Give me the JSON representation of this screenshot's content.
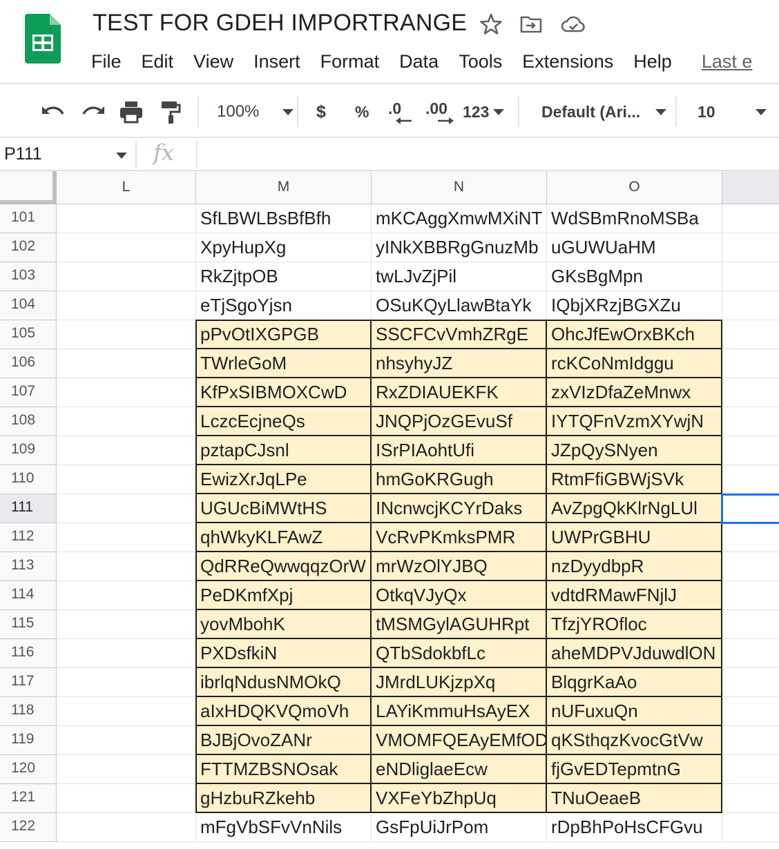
{
  "app": {
    "doc_title": "TEST FOR GDEH IMPORTRANGE",
    "icons": [
      "sheets-logo-icon",
      "star-icon",
      "move-to-folder-icon",
      "cloud-status-icon"
    ],
    "brand_color": "#0f9d58"
  },
  "menu": {
    "items": [
      "File",
      "Edit",
      "View",
      "Insert",
      "Format",
      "Data",
      "Tools",
      "Extensions",
      "Help"
    ],
    "last_edit": "Last e"
  },
  "toolbar": {
    "zoom": "100%",
    "currency": "$",
    "percent": "%",
    "decrease_decimals": ".0",
    "increase_decimals": ".00",
    "more_formats": "123",
    "font": "Default (Ari...",
    "font_size": "10"
  },
  "formula_bar": {
    "cell_ref": "P111",
    "fx": "fx",
    "value": ""
  },
  "sheet": {
    "columns": [
      "L",
      "M",
      "N",
      "O"
    ],
    "selected_row": 111,
    "highlight_color": "#fff2cc",
    "selection_color": "#1a73e8",
    "rows": [
      {
        "num": "101",
        "M": "SfLBWLBsBfBfh",
        "N": "mKCAggXmwMXiNT",
        "O": "WdSBmRnoMSBa"
      },
      {
        "num": "102",
        "M": "XpyHupXg",
        "N": "yINkXBBRgGnuzMb",
        "O": "uGUWUaHM"
      },
      {
        "num": "103",
        "M": "RkZjtpOB",
        "N": "twLJvZjPil",
        "O": "GKsBgMpn"
      },
      {
        "num": "104",
        "M": "eTjSgoYjsn",
        "N": "OSuKQyLlawBtaYk",
        "O": "IQbjXRzjBGXZu"
      },
      {
        "num": "105",
        "M": "pPvOtIXGPGB",
        "N": "SSCFCvVmhZRgE",
        "O": "OhcJfEwOrxBKch"
      },
      {
        "num": "106",
        "M": "TWrleGoM",
        "N": "nhsyhyJZ",
        "O": "rcKCoNmIdggu"
      },
      {
        "num": "107",
        "M": "KfPxSIBMOXCwD",
        "N": "RxZDIAUEKFK",
        "O": "zxVIzDfaZeMnwx"
      },
      {
        "num": "108",
        "M": "LczcEcjneQs",
        "N": "JNQPjOzGEvuSf",
        "O": "IYTQFnVzmXYwjN"
      },
      {
        "num": "109",
        "M": "pztapCJsnl",
        "N": "ISrPIAohtUfi",
        "O": "JZpQySNyen"
      },
      {
        "num": "110",
        "M": "EwizXrJqLPe",
        "N": "hmGoKRGugh",
        "O": "RtmFfiGBWjSVk"
      },
      {
        "num": "111",
        "M": "UGUcBiMWtHS",
        "N": "INcnwcjKCYrDaks",
        "O": "AvZpgQkKlrNgLUl"
      },
      {
        "num": "112",
        "M": "qhWkyKLFAwZ",
        "N": "VcRvPKmksPMR",
        "O": "UWPrGBHU"
      },
      {
        "num": "113",
        "M": "QdRReQwwqqzOrW",
        "N": "mrWzOlYJBQ",
        "O": "nzDyydbpR"
      },
      {
        "num": "114",
        "M": "PeDKmfXpj",
        "N": "OtkqVJyQx",
        "O": "vdtdRMawFNjlJ"
      },
      {
        "num": "115",
        "M": "yovMbohK",
        "N": "tMSMGylAGUHRpt",
        "O": "TfzjYROfloc"
      },
      {
        "num": "116",
        "M": "PXDsfkiN",
        "N": "QTbSdokbfLc",
        "O": "aheMDPVJduwdlON"
      },
      {
        "num": "117",
        "M": "ibrlqNdusNMOkQ",
        "N": "JMrdLUKjzpXq",
        "O": "BlqgrKaAo"
      },
      {
        "num": "118",
        "M": "aIxHDQKVQmoVh",
        "N": "LAYiKmmuHsAyEX",
        "O": "nUFuxuQn"
      },
      {
        "num": "119",
        "M": "BJBjOvoZANr",
        "N": "VMOMFQEAyEMfOD",
        "O": "qKSthqzKvocGtVw"
      },
      {
        "num": "120",
        "M": "FTTMZBSNOsak",
        "N": "eNDliglaeEcw",
        "O": "fjGvEDTepmtnG"
      },
      {
        "num": "121",
        "M": "gHzbuRZkehb",
        "N": "VXFeYbZhpUq",
        "O": "TNuOeaeB"
      },
      {
        "num": "122",
        "M": "mFgVbSFvVnNils",
        "N": "GsFpUiJrPom",
        "O": "rDpBhPoHsCFGvu"
      }
    ]
  }
}
